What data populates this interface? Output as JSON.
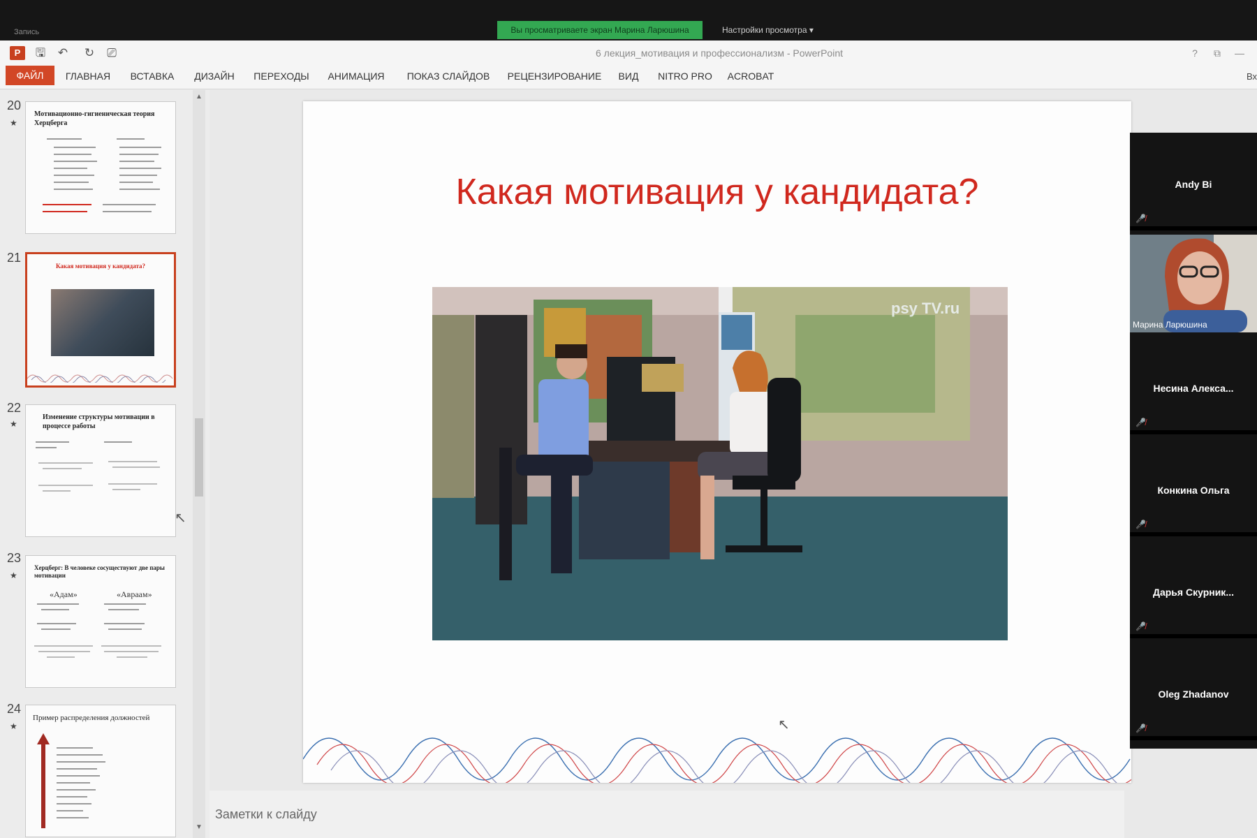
{
  "zoom": {
    "share_banner": "Вы просматриваете экран Марина Ларюшина",
    "view_options": "Настройки просмотра",
    "top_left_status": "Запись"
  },
  "app": {
    "logo_letter": "P",
    "title": "6 лекция_мотивация и профессионализм - PowerPoint",
    "window_controls": [
      "?",
      "⧉",
      "—"
    ]
  },
  "ribbon": {
    "tabs": [
      "ФАЙЛ",
      "ГЛАВНАЯ",
      "ВСТАВКА",
      "ДИЗАЙН",
      "ПЕРЕХОДЫ",
      "АНИМАЦИЯ",
      "ПОКАЗ СЛАЙДОВ",
      "РЕЦЕНЗИРОВАНИЕ",
      "ВИД",
      "NITRO PRO",
      "ACROBAT"
    ],
    "edge_label": "Вх"
  },
  "thumbnails": [
    {
      "number": "20",
      "title": "Мотивационно-гигиеническая теория Херцберга"
    },
    {
      "number": "21",
      "title": "Какая мотивация у кандидата?",
      "selected": true
    },
    {
      "number": "22",
      "title": "Изменение структуры мотивации в процессе работы"
    },
    {
      "number": "23",
      "title": "Херцберг: В человеке сосуществуют две пары мотивации",
      "col_a": "«Адам»",
      "col_b": "«Авраам»"
    },
    {
      "number": "24",
      "title": "Пример распределения должностей"
    }
  ],
  "slide": {
    "title": "Какая мотивация у кандидата?",
    "photo_watermark": "psy TV.ru"
  },
  "notes": {
    "label": "Заметки к слайду"
  },
  "participants": [
    {
      "name": "Andy Bi"
    },
    {
      "name": "Марина Ларюшина",
      "video": true
    },
    {
      "name": "Несина Алекса..."
    },
    {
      "name": "Конкина Ольга"
    },
    {
      "name": "Дарья Скурник..."
    },
    {
      "name": "Oleg Zhadanov"
    }
  ],
  "colors": {
    "accent": "#d24726",
    "slide_title": "#d0281e",
    "zoom_banner": "#33a852"
  }
}
